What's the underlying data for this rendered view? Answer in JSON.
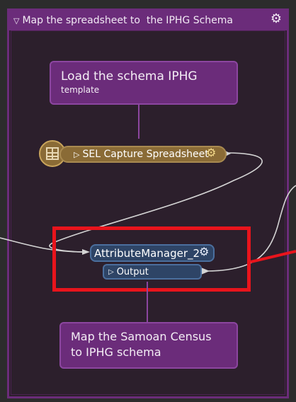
{
  "bookmark": {
    "title": "Map the spreadsheet to  the IPHG Schema",
    "collapse_glyph": "▽",
    "gear_glyph": "⚙"
  },
  "annotations": {
    "load": {
      "line1": "Load the schema IPHG",
      "line2": "template"
    },
    "map": {
      "line1": "Map the Samoan Census",
      "line2": "to IPHG schema"
    }
  },
  "reader": {
    "label": "SEL Capture Spreadsheet",
    "expand_glyph": "▷",
    "gear_glyph": "⚙"
  },
  "transformer": {
    "label": "AttributeManager_2",
    "gear_glyph": "⚙",
    "port_label": "Output",
    "port_glyph": "▷"
  },
  "colors": {
    "bookmark": "#6b2c7a",
    "reader": "#8a6b36",
    "transformer": "#2e4466",
    "highlight": "#e8141c"
  }
}
